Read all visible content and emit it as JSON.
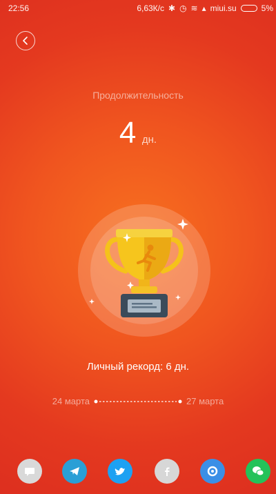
{
  "status_bar": {
    "time": "22:56",
    "right_text": "6,63К/с",
    "carrier": "miui.su",
    "battery": "5%"
  },
  "header": {
    "title": "Продолжительность"
  },
  "summary": {
    "value": "4",
    "unit": "дн."
  },
  "record": {
    "label": "Личный рекорд: 6 дн."
  },
  "range": {
    "start": "24 марта",
    "end": "27 марта"
  },
  "share": {
    "items": [
      {
        "icon": "message-icon",
        "color": "#d9d9d9"
      },
      {
        "icon": "telegram-icon",
        "color": "#2a9fd6"
      },
      {
        "icon": "twitter-icon",
        "color": "#1da1f2"
      },
      {
        "icon": "facebook-icon",
        "color": "#d7d7d7"
      },
      {
        "icon": "browser-icon",
        "color": "#3b8fe6"
      },
      {
        "icon": "wechat-icon",
        "color": "#24c25a"
      }
    ]
  }
}
